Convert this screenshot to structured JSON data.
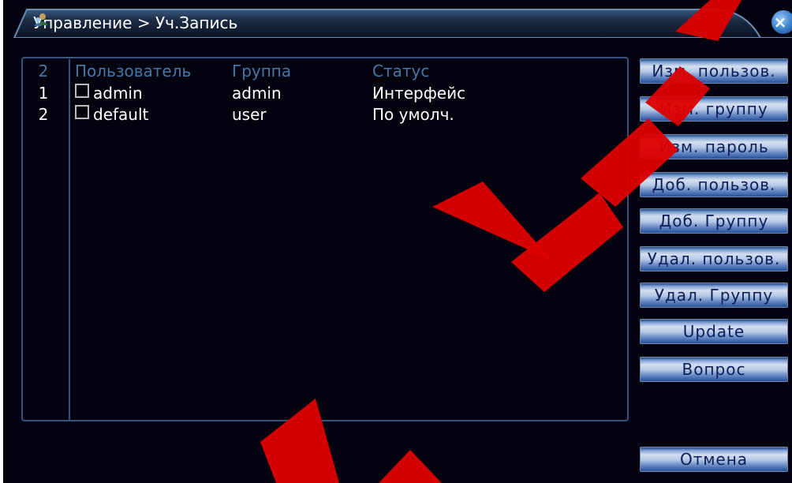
{
  "window": {
    "title": "Управление > Уч.Запись",
    "close_label": "×"
  },
  "list": {
    "header": {
      "count": "2",
      "user": "Пользователь",
      "group": "Группа",
      "status": "Статус"
    },
    "rows": [
      {
        "num": "1",
        "user": "admin",
        "group": "admin",
        "status": "Интерфейс",
        "checked": false
      },
      {
        "num": "2",
        "user": "default",
        "group": "user",
        "status": "По умолч.",
        "checked": false
      }
    ]
  },
  "buttons": {
    "edit_user": "Изм. пользов.",
    "edit_group": "Изм. группу",
    "edit_password": "Изм. пароль",
    "add_user": "Доб. пользов.",
    "add_group": "Доб. Группу",
    "delete_user": "Удал. пользов.",
    "delete_group": "Удал. Группу",
    "update": "Update",
    "question": "Вопрос",
    "cancel": "Отмена"
  },
  "colors": {
    "background": "#03030f",
    "header_text": "#4477a8",
    "frame": "#34557d",
    "watermark": "#dd0000"
  },
  "icons": {
    "title": "user-icon",
    "close": "close-icon"
  }
}
